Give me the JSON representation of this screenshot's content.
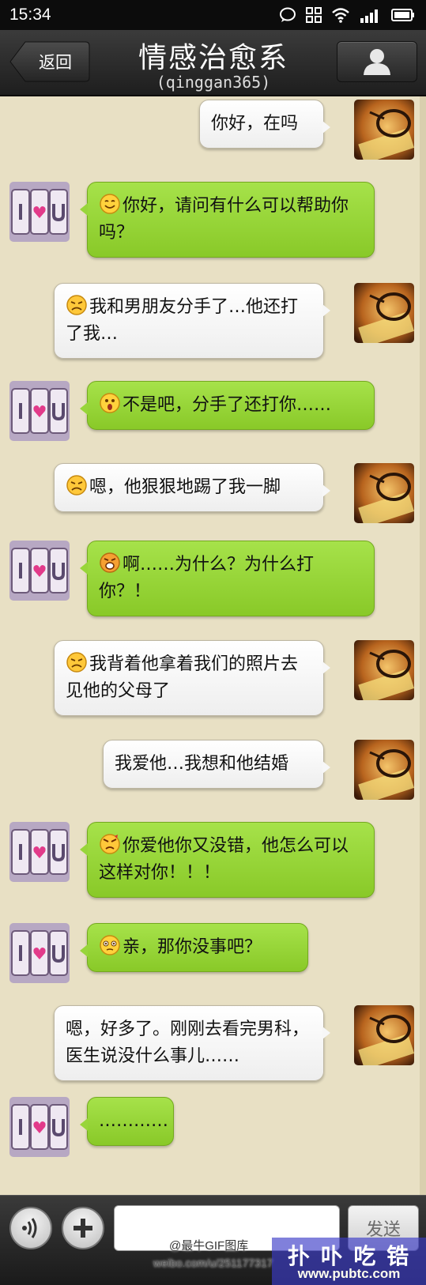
{
  "status_bar": {
    "time": "15:34"
  },
  "header": {
    "back_label": "返回",
    "title": "情感治愈系",
    "subtitle": "(qinggan365)"
  },
  "messages": [
    {
      "side": "right",
      "text": "你好，在吗",
      "emoji": ""
    },
    {
      "side": "left",
      "text": "你好，请问有什么可以帮助你吗？",
      "emoji": "smile"
    },
    {
      "side": "right",
      "text": "我和男朋友分手了…他还打了我…",
      "emoji": "sad"
    },
    {
      "side": "left",
      "text": "不是吧，分手了还打你……",
      "emoji": "surprised"
    },
    {
      "side": "right",
      "text": "嗯，他狠狠地踢了我一脚",
      "emoji": "sad"
    },
    {
      "side": "left",
      "text": "啊……为什么？为什么打你？！",
      "emoji": "shocked"
    },
    {
      "side": "right",
      "text": "我背着他拿着我们的照片去见他的父母了",
      "emoji": "sad"
    },
    {
      "side": "right",
      "text": "我爱他…我想和他结婚",
      "emoji": ""
    },
    {
      "side": "left",
      "text": "你爱他你又没错，他怎么可以这样对你！！！",
      "emoji": "angry"
    },
    {
      "side": "left",
      "text": "亲，那你没事吧？",
      "emoji": "worried"
    },
    {
      "side": "right",
      "text": "嗯，好多了。刚刚去看完男科，医生说没什么事儿……",
      "emoji": ""
    },
    {
      "side": "left",
      "text": "…………",
      "emoji": ""
    }
  ],
  "bottom_bar": {
    "send_label": "发送",
    "weibo_credit": "@最牛GIF图库",
    "weibo_url": "weibo.com/u/251177317"
  },
  "watermark": {
    "main": "扑 卟 吃 锆",
    "sub": "www.pubtc.com"
  },
  "colors": {
    "background": "#e8e0c4",
    "bubble_green": "#98d53a",
    "bubble_white": "#f7f7f7",
    "header": "#2b2b2b"
  }
}
